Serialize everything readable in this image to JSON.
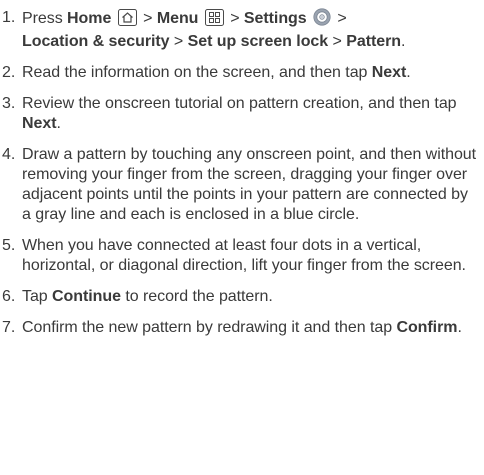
{
  "steps": [
    {
      "num": "1.",
      "press": "Press ",
      "home": "Home",
      "gt1": " > ",
      "menu": "Menu",
      "gt2": " > ",
      "settings": "Settings",
      "gt3": " >",
      "location": "Location & security",
      "gt4": " > ",
      "screenlock": "Set up screen lock",
      "gt5": " > ",
      "pattern": "Pattern",
      "end": "."
    },
    {
      "num": "2.",
      "pre": "Read the information on the screen, and then tap ",
      "bold": "Next",
      "post": "."
    },
    {
      "num": "3.",
      "pre": "Review the onscreen tutorial on pattern creation, and then tap ",
      "bold": "Next",
      "post": "."
    },
    {
      "num": "4.",
      "text": "Draw a pattern by touching any onscreen point, and then without removing your finger from the screen, dragging your finger over adjacent points until the points in your pattern are connected by a gray line and each is enclosed in a blue circle."
    },
    {
      "num": "5.",
      "text": "When you have connected at least four dots in a vertical, horizontal, or diagonal direction, lift your finger from the screen."
    },
    {
      "num": "6.",
      "pre": "Tap ",
      "bold": "Continue",
      "post": " to record the pattern."
    },
    {
      "num": "7.",
      "pre": "Confirm the new pattern by redrawing it and then tap ",
      "bold": "Confirm",
      "post": "."
    }
  ],
  "icons": {
    "home": "home-icon",
    "menu": "menu-grid-icon",
    "settings": "settings-gear-icon"
  },
  "colors": {
    "text": "#3a3a3a",
    "icon_stroke": "#4a4a4a",
    "settings_icon": "#9aa3b0"
  }
}
